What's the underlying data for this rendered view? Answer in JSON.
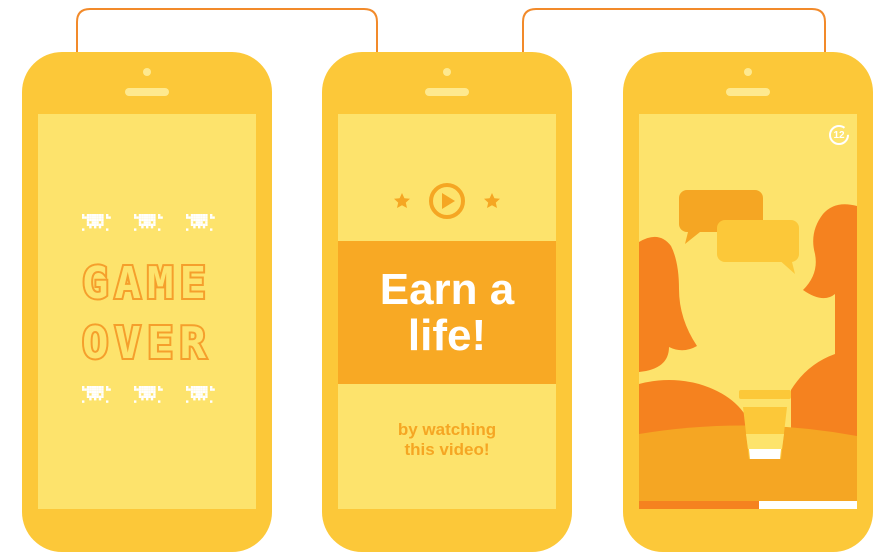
{
  "phones": [
    {
      "id": "game-over",
      "pixel_words": [
        "GAME",
        "OVER"
      ]
    },
    {
      "id": "earn-life",
      "title_lines": [
        "Earn a",
        "life!"
      ],
      "subtitle_lines": [
        "by watching",
        "this video!"
      ]
    },
    {
      "id": "video-ad",
      "timer": "12",
      "progress_fraction": 0.55
    }
  ],
  "colors": {
    "phone_body": "#fcc839",
    "screen": "#fde36c",
    "banner": "#f8a924",
    "accent_text": "#f5a623",
    "connector": "#f28a2a",
    "white": "#ffffff"
  },
  "icons": [
    "skull-icon",
    "star-icon",
    "play-icon",
    "timer-icon",
    "speech-bubble-icon",
    "coffee-cup-icon"
  ]
}
